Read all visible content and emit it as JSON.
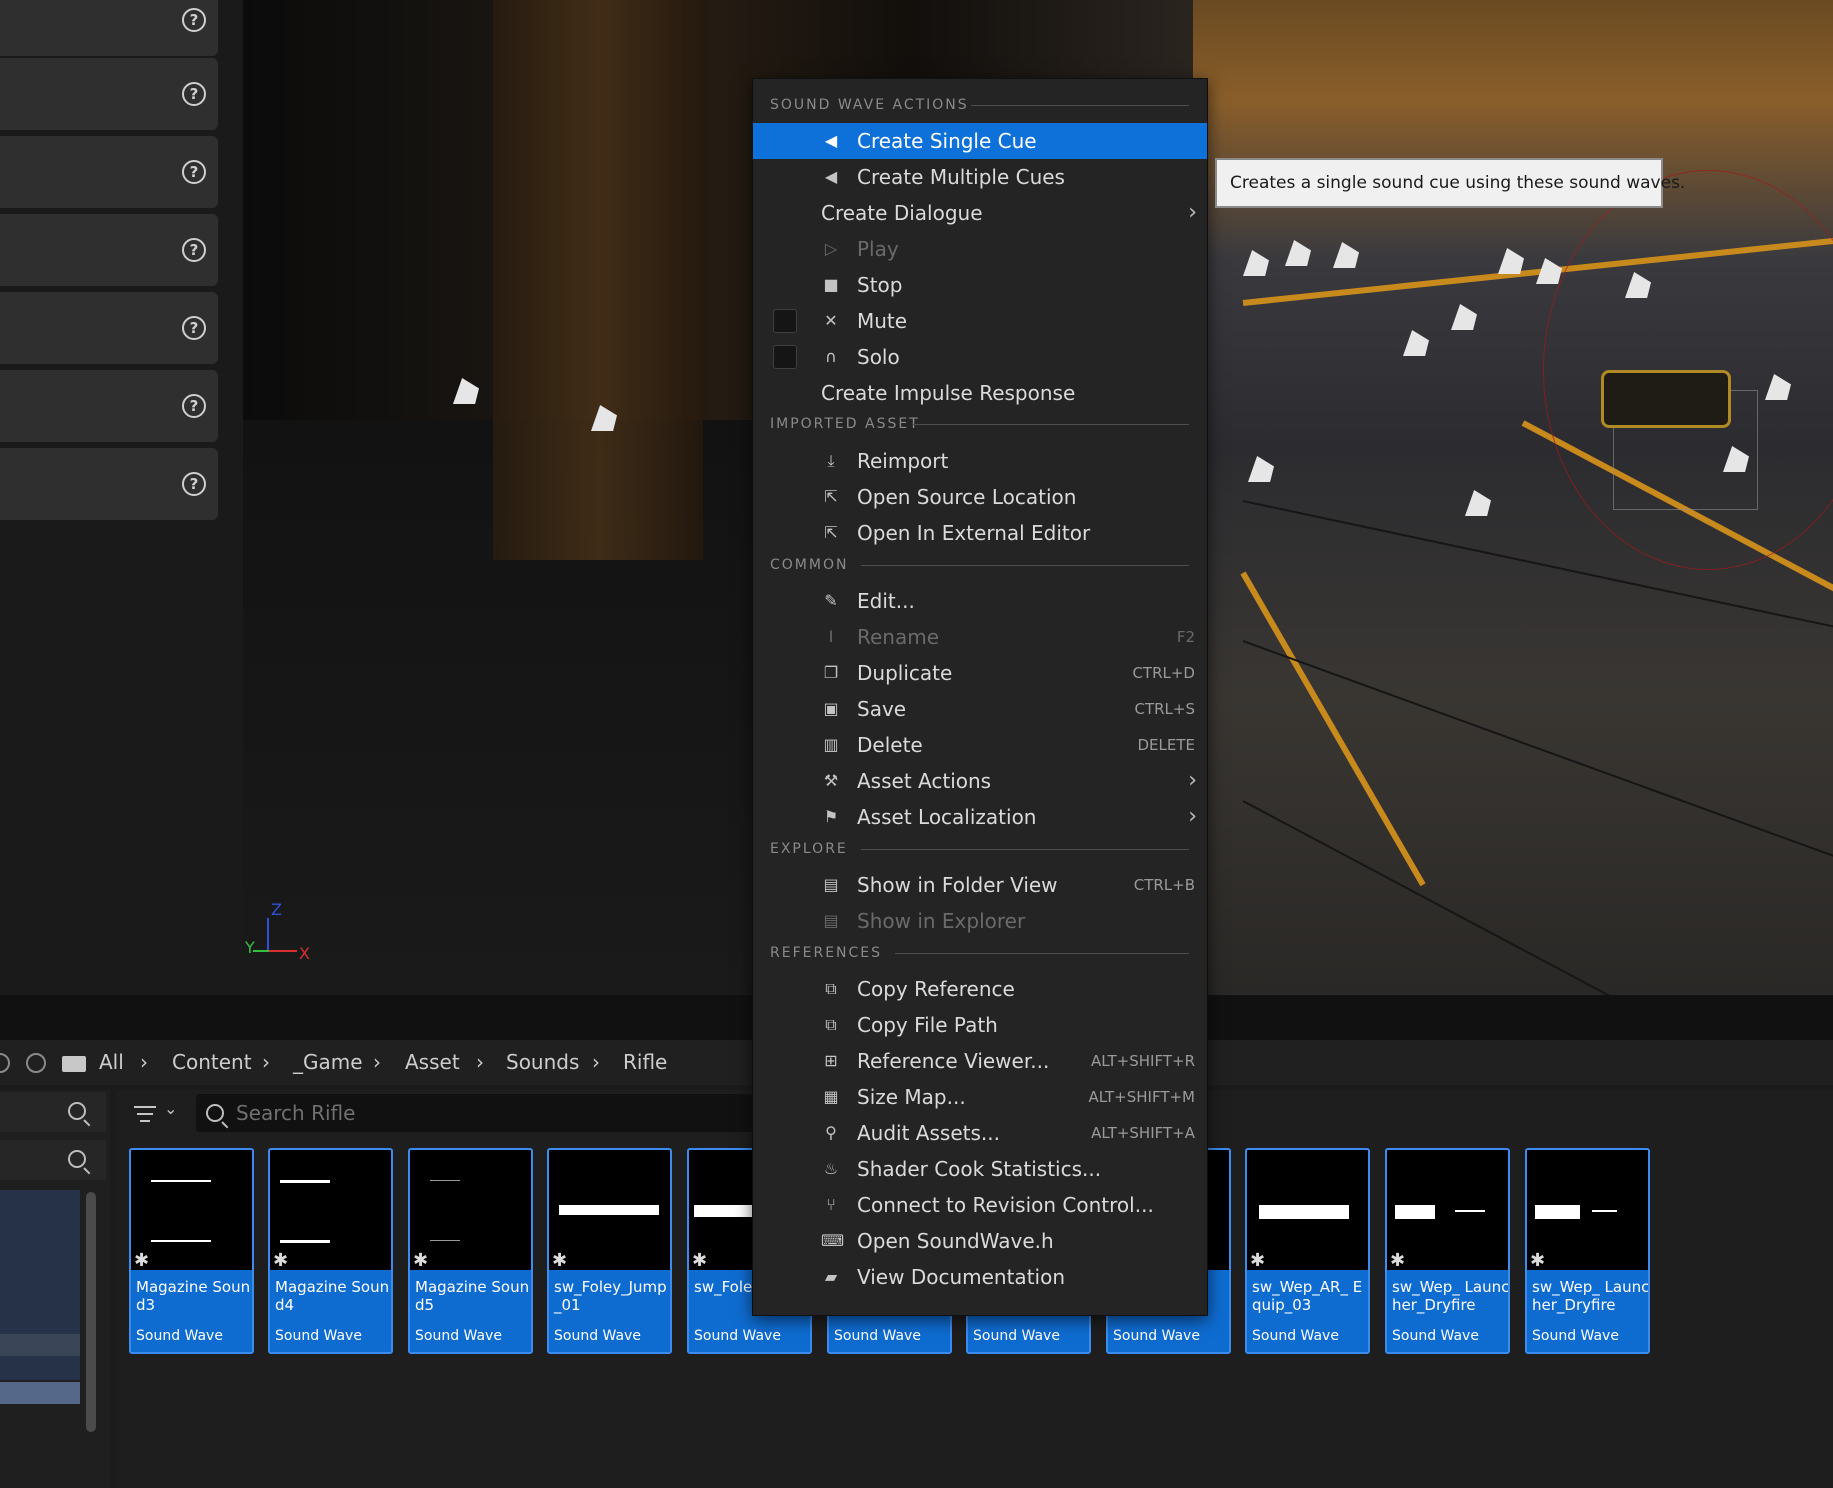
{
  "details_panel": {
    "help_rows": [
      {
        "icon": "help-icon",
        "glyph": "?"
      },
      {
        "icon": "help-icon",
        "glyph": "?"
      },
      {
        "icon": "help-icon",
        "glyph": "?"
      },
      {
        "icon": "help-icon",
        "glyph": "?"
      },
      {
        "icon": "help-icon",
        "glyph": "?"
      },
      {
        "icon": "help-icon",
        "glyph": "?"
      },
      {
        "icon": "help-icon",
        "glyph": "?"
      }
    ]
  },
  "viewport": {
    "axes": {
      "x": "X",
      "y": "Y",
      "z": "Z"
    }
  },
  "context_menu": {
    "sections": {
      "sound_wave_actions": "SOUND WAVE ACTIONS",
      "imported_asset": "IMPORTED ASSET",
      "common": "COMMON",
      "explore": "EXPLORE",
      "references": "REFERENCES"
    },
    "items": {
      "create_single_cue": {
        "label": "Create Single Cue",
        "icon": "speaker-icon",
        "highlighted": true
      },
      "create_multiple_cues": {
        "label": "Create Multiple Cues",
        "icon": "speaker-icon"
      },
      "create_dialogue": {
        "label": "Create Dialogue",
        "submenu": true
      },
      "play": {
        "label": "Play",
        "icon": "play-icon",
        "disabled": true
      },
      "stop": {
        "label": "Stop",
        "icon": "stop-icon"
      },
      "mute": {
        "label": "Mute",
        "icon": "mute-icon",
        "checked": false
      },
      "solo": {
        "label": "Solo",
        "icon": "headphones-icon",
        "checked": false
      },
      "create_impulse_response": {
        "label": "Create Impulse Response"
      },
      "reimport": {
        "label": "Reimport",
        "icon": "reimport-icon"
      },
      "open_source_location": {
        "label": "Open Source Location",
        "icon": "open-location-icon"
      },
      "open_in_external_editor": {
        "label": "Open In External Editor",
        "icon": "external-editor-icon"
      },
      "edit": {
        "label": "Edit...",
        "icon": "pencil-icon"
      },
      "rename": {
        "label": "Rename",
        "icon": "rename-icon",
        "shortcut": "F2",
        "disabled": true
      },
      "duplicate": {
        "label": "Duplicate",
        "icon": "duplicate-icon",
        "shortcut": "CTRL+D"
      },
      "save": {
        "label": "Save",
        "icon": "save-icon",
        "shortcut": "CTRL+S"
      },
      "delete": {
        "label": "Delete",
        "icon": "trash-icon",
        "shortcut": "DELETE"
      },
      "asset_actions": {
        "label": "Asset Actions",
        "icon": "wrench-icon",
        "submenu": true
      },
      "asset_localization": {
        "label": "Asset Localization",
        "icon": "flag-icon",
        "submenu": true
      },
      "show_in_folder_view": {
        "label": "Show in Folder View",
        "icon": "folder-search-icon",
        "shortcut": "CTRL+B"
      },
      "show_in_explorer": {
        "label": "Show in Explorer",
        "icon": "folder-search-icon",
        "disabled": true
      },
      "copy_reference": {
        "label": "Copy Reference",
        "icon": "copy-icon"
      },
      "copy_file_path": {
        "label": "Copy File Path",
        "icon": "copy-icon"
      },
      "reference_viewer": {
        "label": "Reference Viewer...",
        "icon": "reference-viewer-icon",
        "shortcut": "ALT+SHIFT+R"
      },
      "size_map": {
        "label": "Size Map...",
        "icon": "size-map-icon",
        "shortcut": "ALT+SHIFT+M"
      },
      "audit_assets": {
        "label": "Audit Assets...",
        "icon": "audit-icon",
        "shortcut": "ALT+SHIFT+A"
      },
      "shader_cook_statistics": {
        "label": "Shader Cook Statistics...",
        "icon": "shader-icon"
      },
      "connect_revision_control": {
        "label": "Connect to Revision Control...",
        "icon": "branch-icon"
      },
      "open_soundwave_h": {
        "label": "Open SoundWave.h",
        "icon": "code-icon"
      },
      "view_documentation": {
        "label": "View Documentation",
        "icon": "book-icon"
      }
    }
  },
  "tooltip": {
    "text": "Creates a single sound cue using these sound waves."
  },
  "content_browser": {
    "breadcrumb": [
      "All",
      "Content",
      "_Game",
      "Asset",
      "Sounds",
      "Rifle"
    ],
    "search": {
      "placeholder": "Search Rifle"
    },
    "tiles": [
      {
        "name": "Magazine Sound3",
        "type": "Sound Wave"
      },
      {
        "name": "Magazine Sound4",
        "type": "Sound Wave"
      },
      {
        "name": "Magazine Sound5",
        "type": "Sound Wave"
      },
      {
        "name": "sw_Foley_Jump _01",
        "type": "Sound Wave"
      },
      {
        "name": "sw_Fole _02",
        "type": "Sound Wave"
      },
      {
        "name": "",
        "type": "Sound Wave"
      },
      {
        "name": "",
        "type": "Sound Wave"
      },
      {
        "name": "",
        "type": "Sound Wave"
      },
      {
        "name": "sw_Wep_AR_ Equip_03",
        "type": "Sound Wave"
      },
      {
        "name": "sw_Wep_ Launcher_Dryfire",
        "type": "Sound Wave"
      },
      {
        "name": "sw_Wep_ Launcher_Dryfire",
        "type": "Sound Wave"
      }
    ]
  },
  "colors": {
    "highlight": "#0e71d9",
    "tile_blue": "#0e6cd1",
    "menu_bg": "#242424"
  }
}
